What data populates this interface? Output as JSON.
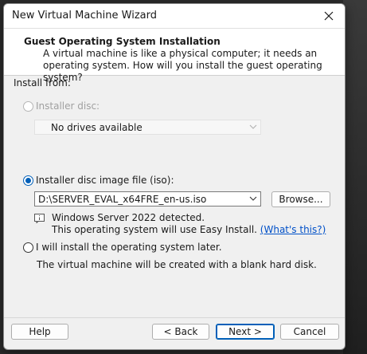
{
  "window": {
    "title": "New Virtual Machine Wizard"
  },
  "header": {
    "title": "Guest Operating System Installation",
    "description": "A virtual machine is like a physical computer; it needs an operating system. How will you install the guest operating system?"
  },
  "install_from": {
    "label": "Install from:",
    "installer_disc": {
      "label": "Installer disc:",
      "selected": false,
      "enabled": false,
      "dropdown_value": "No drives available"
    },
    "iso": {
      "label": "Installer disc image file (iso):",
      "selected": true,
      "path": "D:\\SERVER_EVAL_x64FRE_en-us.iso",
      "browse_label": "Browse...",
      "detected_text": "Windows Server 2022 detected.",
      "easy_install_text": "This operating system will use Easy Install.",
      "whats_this_link": "(What's this?)",
      "info_icon": "info-icon"
    },
    "later": {
      "label": "I will install the operating system later.",
      "selected": false,
      "description": "The virtual machine will be created with a blank hard disk."
    }
  },
  "footer": {
    "help_label": "Help",
    "back_label": "< Back",
    "next_label": "Next >",
    "cancel_label": "Cancel"
  },
  "colors": {
    "accent": "#005fb8",
    "link": "#0050c8",
    "dialog_bg": "#f0f0f0"
  }
}
